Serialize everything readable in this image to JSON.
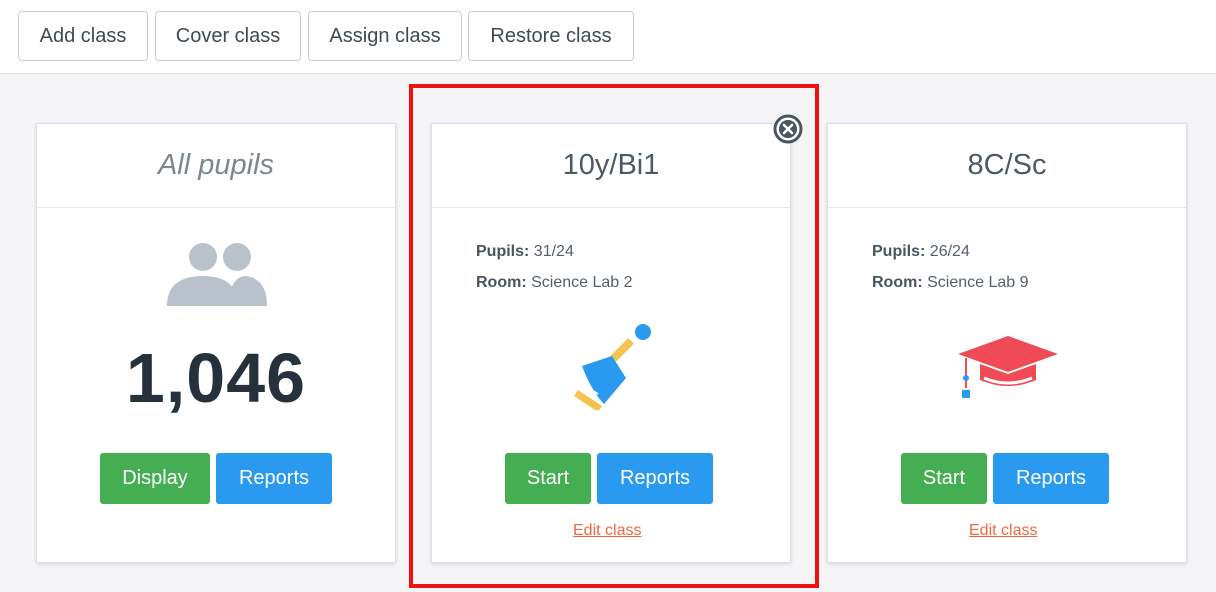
{
  "toolbar": {
    "add_label": "Add class",
    "cover_label": "Cover class",
    "assign_label": "Assign class",
    "restore_label": "Restore class"
  },
  "all_pupils": {
    "title": "All pupils",
    "icon": "users-icon",
    "count": "1,046",
    "display_label": "Display",
    "reports_label": "Reports"
  },
  "classes": [
    {
      "title": "10y/Bi1",
      "pupils_label": "Pupils:",
      "pupils_value": "31/24",
      "room_label": "Room:",
      "room_value": "Science Lab 2",
      "icon": "bell-icon",
      "start_label": "Start",
      "reports_label": "Reports",
      "edit_label": "Edit class"
    },
    {
      "title": "8C/Sc",
      "pupils_label": "Pupils:",
      "pupils_value": "26/24",
      "room_label": "Room:",
      "room_value": "Science Lab 9",
      "icon": "graduation-cap-icon",
      "start_label": "Start",
      "reports_label": "Reports",
      "edit_label": "Edit class"
    }
  ],
  "colors": {
    "green": "#45ae52",
    "blue": "#2a99f0",
    "link": "#f0683f",
    "highlight": "#ee1111"
  }
}
